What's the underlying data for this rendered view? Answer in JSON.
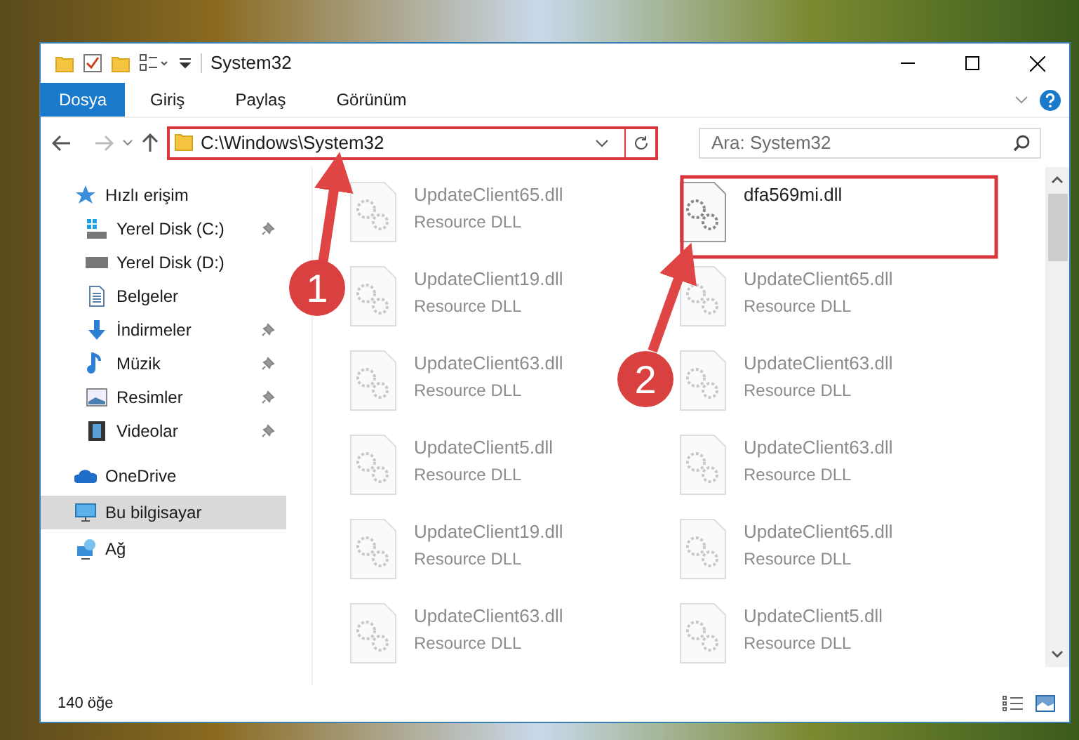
{
  "window": {
    "title": "System32"
  },
  "ribbon_tabs": [
    {
      "label": "Dosya",
      "selected": true
    },
    {
      "label": "Giriş",
      "selected": false
    },
    {
      "label": "Paylaş",
      "selected": false
    },
    {
      "label": "Görünüm",
      "selected": false
    }
  ],
  "address_bar": {
    "path": "C:\\Windows\\System32"
  },
  "search": {
    "placeholder": "Ara: System32"
  },
  "sidebar": {
    "items": [
      {
        "label": "Hızlı erişim",
        "kind": "star",
        "pinned": false,
        "selected": false
      },
      {
        "label": "Yerel Disk (C:)",
        "kind": "drive-win",
        "pinned": true,
        "selected": false
      },
      {
        "label": "Yerel Disk (D:)",
        "kind": "drive",
        "pinned": false,
        "selected": false
      },
      {
        "label": "Belgeler",
        "kind": "doc",
        "pinned": false,
        "selected": false
      },
      {
        "label": "İndirmeler",
        "kind": "download",
        "pinned": true,
        "selected": false
      },
      {
        "label": "Müzik",
        "kind": "music",
        "pinned": true,
        "selected": false
      },
      {
        "label": "Resimler",
        "kind": "picture",
        "pinned": true,
        "selected": false
      },
      {
        "label": "Videolar",
        "kind": "video",
        "pinned": true,
        "selected": false
      },
      {
        "label": "OneDrive",
        "kind": "cloud",
        "pinned": false,
        "selected": false
      },
      {
        "label": "Bu bilgisayar",
        "kind": "pc",
        "pinned": false,
        "selected": true
      },
      {
        "label": "Ağ",
        "kind": "network",
        "pinned": false,
        "selected": false
      }
    ]
  },
  "files": [
    {
      "name": "UpdateClient65.dll",
      "type": "Resource DLL",
      "blurred": true
    },
    {
      "name": "dfa569mi.dll",
      "blurred": false
    },
    {
      "name": "UpdateClient19.dll",
      "type": "Resource DLL",
      "blurred": true
    },
    {
      "name": "UpdateClient65.dll",
      "type": "Resource DLL",
      "blurred": true
    },
    {
      "name": "UpdateClient63.dll",
      "type": "Resource DLL",
      "blurred": true
    },
    {
      "name": "UpdateClient63.dll",
      "type": "Resource DLL",
      "blurred": true
    },
    {
      "name": "UpdateClient5.dll",
      "type": "Resource DLL",
      "blurred": true
    },
    {
      "name": "UpdateClient63.dll",
      "type": "Resource DLL",
      "blurred": true
    },
    {
      "name": "UpdateClient19.dll",
      "type": "Resource DLL",
      "blurred": true
    },
    {
      "name": "UpdateClient65.dll",
      "type": "Resource DLL",
      "blurred": true
    },
    {
      "name": "UpdateClient63.dll",
      "type": "Resource DLL",
      "blurred": true
    },
    {
      "name": "UpdateClient5.dll",
      "type": "Resource DLL",
      "blurred": true
    }
  ],
  "status_bar": {
    "count": "140 öğe"
  },
  "annotations": [
    {
      "number": "1"
    },
    {
      "number": "2"
    }
  ]
}
